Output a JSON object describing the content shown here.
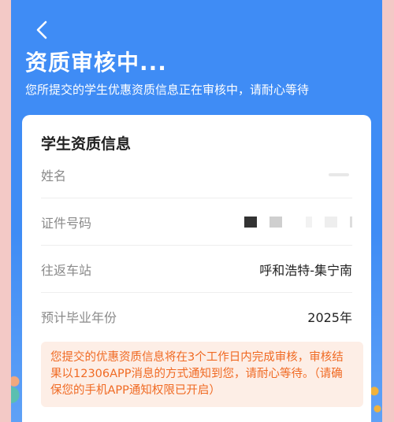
{
  "header": {
    "title": "资质审核中...",
    "subtitle": "您所提交的学生优惠资质信息正在审核中，请耐心等待"
  },
  "card": {
    "title": "学生资质信息",
    "rows": [
      {
        "label": "姓名",
        "value": ""
      },
      {
        "label": "证件号码",
        "value": ""
      },
      {
        "label": "往返车站",
        "value": "呼和浩特-集宁南"
      },
      {
        "label": "预计毕业年份",
        "value": "2025年"
      }
    ],
    "notice": "您提交的优惠资质信息将在3个工作日内完成审核，审核结果以12306APP消息的方式通知到您，请耐心等待。（请确保您的手机APP通知权限已开启）"
  },
  "icons": {
    "back": "chevron-left-icon"
  },
  "colors": {
    "header_bg": "#3f8cf5",
    "notice_text": "#f06a23",
    "notice_bg": "#fdeee6"
  }
}
